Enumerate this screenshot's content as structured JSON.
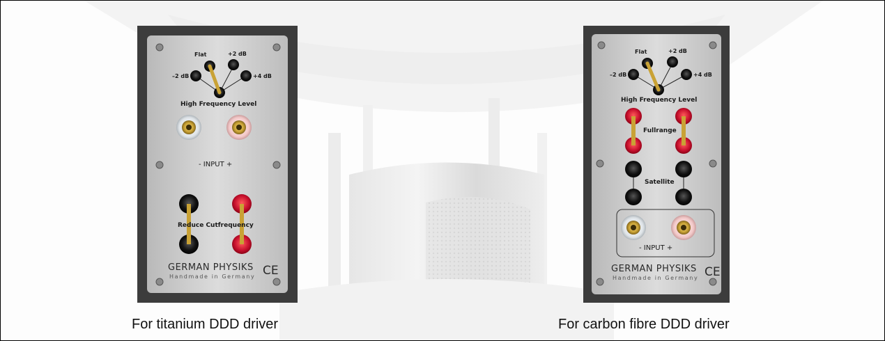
{
  "photos": {
    "background": {
      "kind": "faded speaker photograph"
    },
    "left_panel": {
      "kind": "speaker terminal panel (titanium)",
      "labels": {
        "flat": "Flat",
        "plus2": "+2 dB",
        "minus2": "–2 dB",
        "plus4": "+4 dB",
        "high_freq": "High Frequency Level",
        "input": "- INPUT +",
        "cutfrequency": "Reduce Cutfrequency",
        "brand": "GERMAN PHYSIKS",
        "brand_sub": "Handmade in Germany",
        "ce": "CE"
      },
      "caption": "For titanium DDD driver"
    },
    "right_panel": {
      "kind": "speaker terminal panel (carbon fibre)",
      "labels": {
        "flat": "Flat",
        "plus2": "+2 dB",
        "minus2": "–2 dB",
        "plus4": "+4 dB",
        "high_freq": "High Frequency Level",
        "fullrange": "Fullrange",
        "satellite": "Satellite",
        "input": "- INPUT +",
        "brand": "GERMAN PHYSIKS",
        "brand_sub": "Handmade in Germany",
        "ce": "CE"
      },
      "caption": "For carbon fibre DDD driver"
    }
  },
  "colors": {
    "panel_metal": "#cfcfcf",
    "panel_frame": "#4a4a4a",
    "binding_red": "#c8102e",
    "brass": "#c9a235"
  }
}
